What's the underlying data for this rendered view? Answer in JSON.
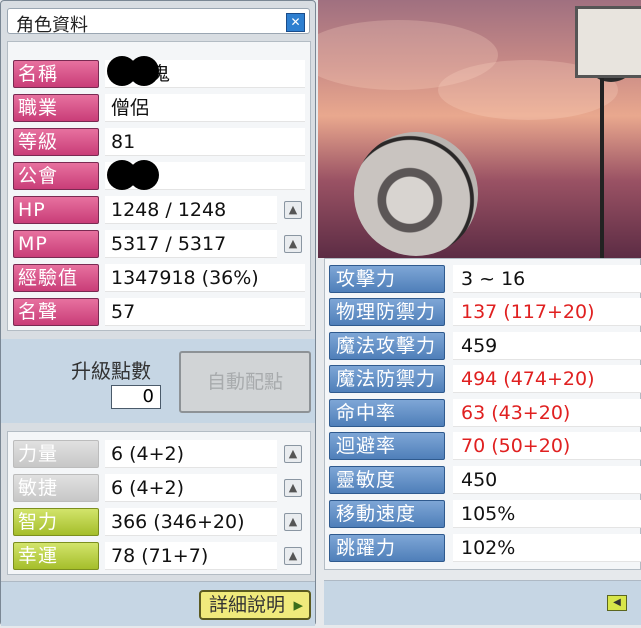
{
  "window": {
    "title": "角色資料",
    "close_icon": "close-icon"
  },
  "profile": [
    {
      "label": "名稱",
      "value": "鬼",
      "redacted": true
    },
    {
      "label": "職業",
      "value": "僧侶"
    },
    {
      "label": "等級",
      "value": "81"
    },
    {
      "label": "公會",
      "value": "",
      "redacted": true
    },
    {
      "label": "HP",
      "value": "1248 / 1248",
      "has_up": true
    },
    {
      "label": "MP",
      "value": "5317 / 5317",
      "has_up": true
    },
    {
      "label": "經驗值",
      "value": "1347918 (36%)"
    },
    {
      "label": "名聲",
      "value": "57"
    }
  ],
  "ability_points": {
    "label": "升級點數",
    "value": "0",
    "auto_button": "自動配點"
  },
  "attributes": [
    {
      "label": "力量",
      "value": "6 (4+2)",
      "style": "grey"
    },
    {
      "label": "敏捷",
      "value": "6 (4+2)",
      "style": "grey"
    },
    {
      "label": "智力",
      "value": "366 (346+20)",
      "style": "green"
    },
    {
      "label": "幸運",
      "value": "78 (71+7)",
      "style": "green"
    }
  ],
  "detail_button": {
    "label": "詳細說明",
    "arrow": "▸"
  },
  "stats": [
    {
      "label": "攻擊力",
      "value": "3 ~ 16",
      "red": false
    },
    {
      "label": "物理防禦力",
      "value": "137 (117+20)",
      "red": true
    },
    {
      "label": "魔法攻擊力",
      "value": "459",
      "red": false
    },
    {
      "label": "魔法防禦力",
      "value": "494 (474+20)",
      "red": true
    },
    {
      "label": "命中率",
      "value": "63 (43+20)",
      "red": true
    },
    {
      "label": "迴避率",
      "value": "70 (50+20)",
      "red": true
    },
    {
      "label": "靈敏度",
      "value": "450",
      "red": false
    },
    {
      "label": "移動速度",
      "value": "105%",
      "red": false
    },
    {
      "label": "跳躍力",
      "value": "102%",
      "red": false
    }
  ],
  "colors": {
    "label_pink": "#d94f86",
    "label_blue": "#5f8dc5",
    "label_green": "#b6cd3a",
    "stat_red": "#e02020"
  }
}
